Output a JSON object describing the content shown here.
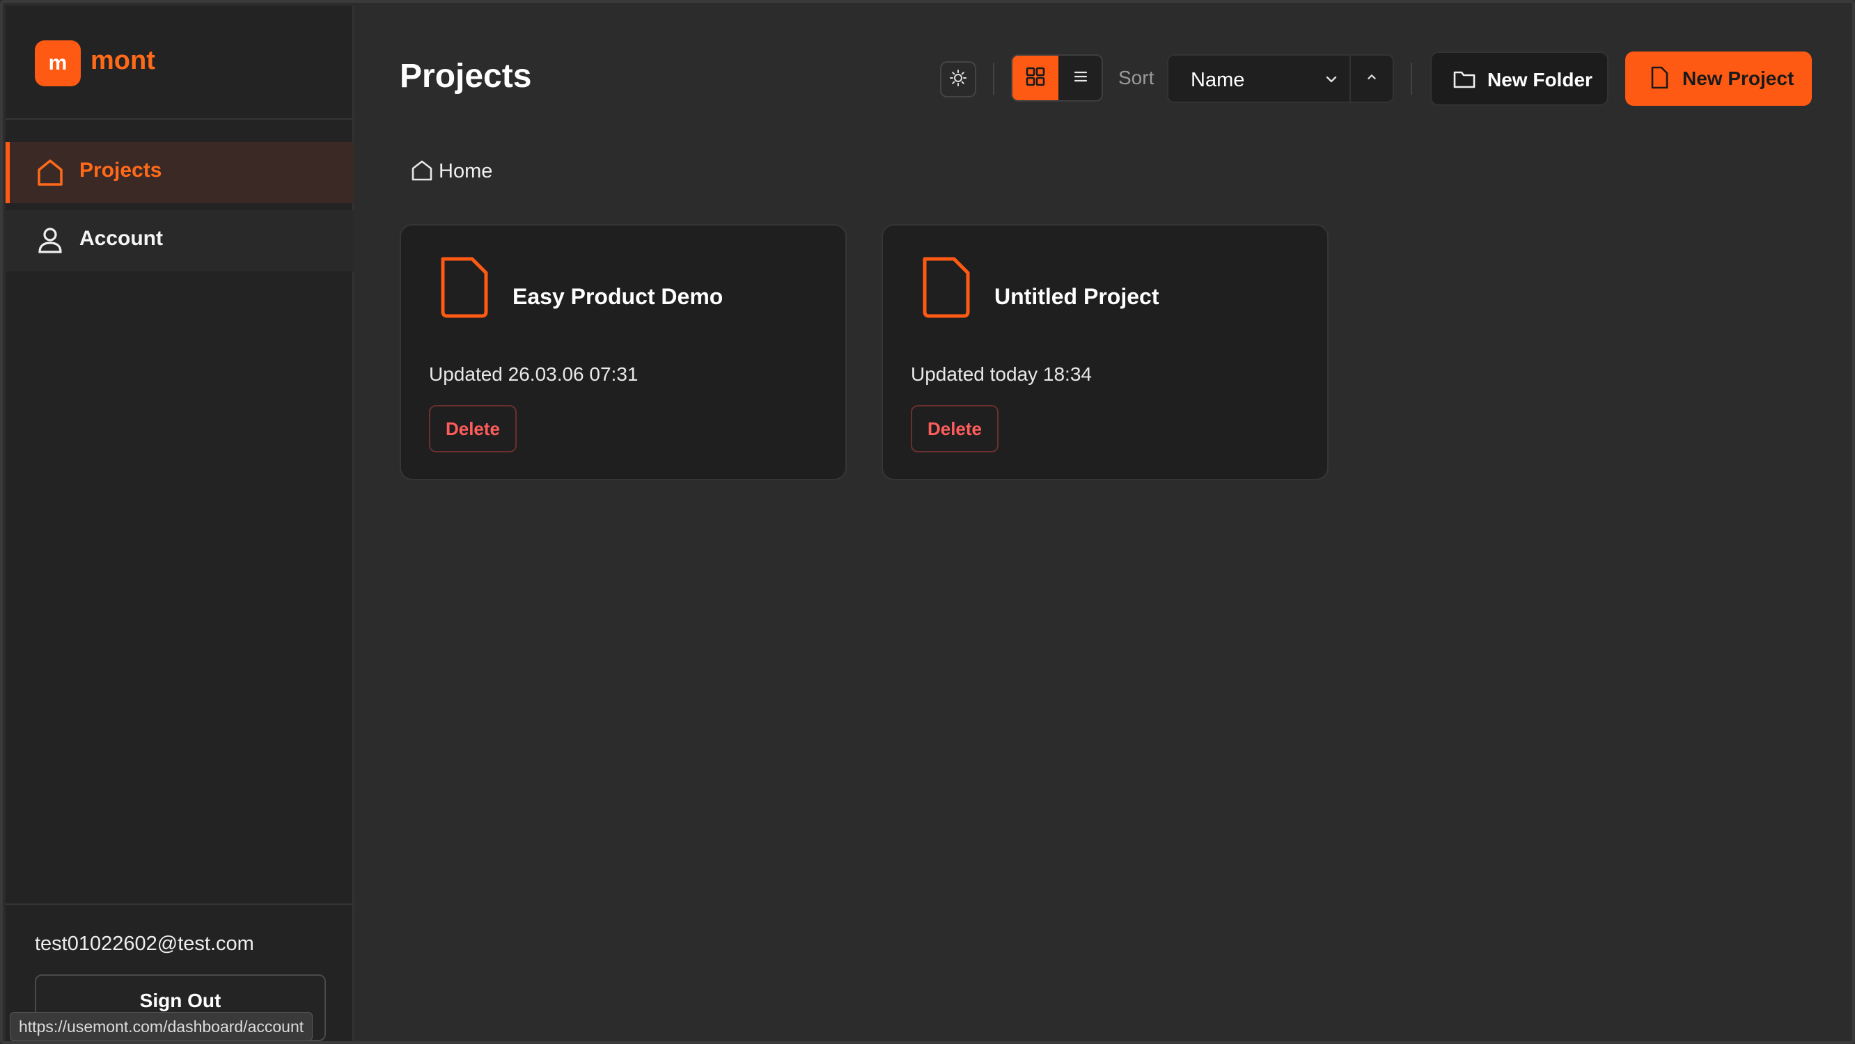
{
  "brand": {
    "logo_letter": "m",
    "name": "mont"
  },
  "sidebar": {
    "items": [
      {
        "label": "Projects",
        "icon": "home-icon",
        "active": true
      },
      {
        "label": "Account",
        "icon": "user-icon",
        "active": false
      }
    ],
    "user_email": "test01022602@test.com",
    "sign_out_label": "Sign Out"
  },
  "status_bar_url": "https://usemont.com/dashboard/account",
  "header": {
    "title": "Projects",
    "sort_label": "Sort",
    "sort_value": "Name",
    "new_folder_label": "New Folder",
    "new_project_label": "New Project",
    "view_mode": "grid"
  },
  "breadcrumb": {
    "label": "Home"
  },
  "projects": [
    {
      "title": "Easy Product Demo",
      "updated": "Updated 26.03.06 07:31",
      "delete_label": "Delete"
    },
    {
      "title": "Untitled Project",
      "updated": "Updated today 18:34",
      "delete_label": "Delete"
    }
  ],
  "colors": {
    "accent": "#ff5a14",
    "danger": "#ff5c5c",
    "background": "#2c2c2c",
    "sidebar": "#232323"
  }
}
